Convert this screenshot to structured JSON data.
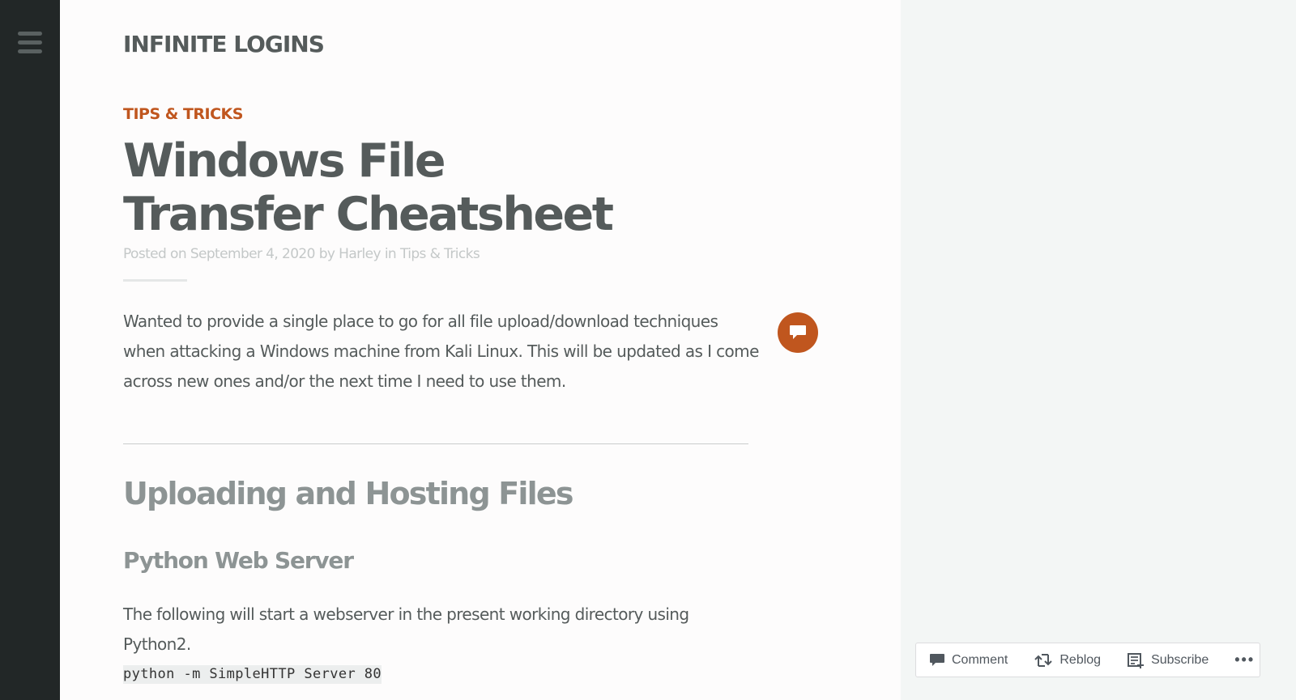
{
  "site": {
    "title": "INFINITE LOGINS"
  },
  "post": {
    "category": "TIPS & TRICKS",
    "title": "Windows File Transfer Cheatsheet",
    "meta": {
      "posted_on_label": "Posted on",
      "date": "September 4, 2020",
      "by_label": "by",
      "author": "Harley",
      "in_label": "in",
      "category_link": "Tips & Tricks"
    },
    "intro": "Wanted to provide a single place to go for all file upload/download techniques when attacking a Windows machine from Kali Linux. This will be updated as I come across new ones and/or the next time I need to use them.",
    "section_heading": "Uploading and Hosting Files",
    "subsection_heading": "Python Web Server",
    "subsection_text": "The following will start a webserver in the present working directory using Python2.",
    "code": "python -m SimpleHTTP Server 80"
  },
  "action_bar": {
    "comment_label": "Comment",
    "reblog_label": "Reblog",
    "subscribe_label": "Subscribe",
    "more_label": "•••"
  },
  "colors": {
    "sidebar": "#222727",
    "accent": "#c0561e",
    "heading": "#555b5b",
    "subheading": "#8d9494",
    "meta": "#c4c8c8"
  },
  "icons": {
    "menu": "hamburger-icon",
    "comment_bubble": "speech-bubble-icon",
    "comment": "comment-icon",
    "reblog": "reblog-icon",
    "subscribe": "subscribe-icon"
  }
}
